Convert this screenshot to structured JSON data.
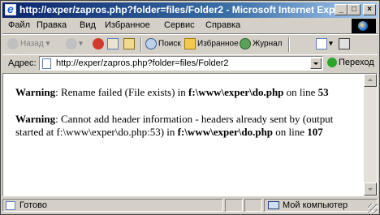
{
  "window": {
    "title": "http://exper/zapros.php?folder=files/Folder2 - Microsoft Internet Explorer",
    "controls": {
      "minimize": "_",
      "maximize": "□",
      "close": "×"
    }
  },
  "menu": [
    "Файл",
    "Правка",
    "Вид",
    "Избранное",
    "Сервис",
    "Справка"
  ],
  "toolbar": {
    "back": "Назад",
    "search": "Поиск",
    "favorites": "Избранное",
    "history": "Журнал"
  },
  "address": {
    "label": "Адрес:",
    "url": "http://exper/zapros.php?folder=files/Folder2",
    "go": "Переход"
  },
  "content": {
    "warning1": {
      "lead": "Warning",
      "text": ": Rename failed (File exists) in ",
      "path": "f:\\www\\exper\\",
      "file": "do.php",
      "mid": " on line ",
      "line": "53"
    },
    "warning2": {
      "lead": "Warning",
      "text": ": Cannot add header information - headers already sent by (output started at f:\\www\\exper\\do.php:53) in ",
      "path": "f:\\www\\exper\\",
      "file": "do.php",
      "mid": " on line ",
      "line": "107"
    }
  },
  "status": {
    "text": "Готово",
    "zone": "Мой компьютер"
  }
}
